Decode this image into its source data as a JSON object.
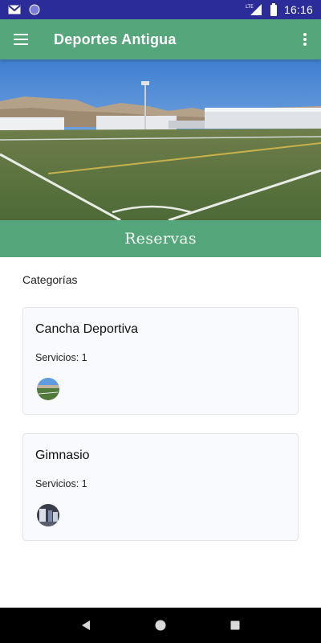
{
  "status_bar": {
    "time": "16:16",
    "network": "LTE",
    "icons": [
      "gmail-icon",
      "circle-notification-icon",
      "lte-icon",
      "signal-icon",
      "battery-icon"
    ]
  },
  "app_bar": {
    "title": "Deportes Antigua",
    "menu_icon": "hamburger-menu-icon",
    "more_icon": "more-vert-icon"
  },
  "hero": {
    "image": "football-stadium-photo"
  },
  "section": {
    "title": "Reservas"
  },
  "categories": {
    "heading": "Categorías",
    "items": [
      {
        "title": "Cancha Deportiva",
        "services": "Servicios: 1",
        "avatar": "field-thumbnail"
      },
      {
        "title": "Gimnasio",
        "services": "Servicios: 1",
        "avatar": "gym-thumbnail"
      }
    ]
  },
  "nav_bar": {
    "back_icon": "back-triangle-icon",
    "home_icon": "home-circle-icon",
    "recents_icon": "recents-square-icon"
  },
  "colors": {
    "status_bar": "#2b2b9a",
    "primary": "#55a67a",
    "card_bg": "#f9fafd"
  }
}
